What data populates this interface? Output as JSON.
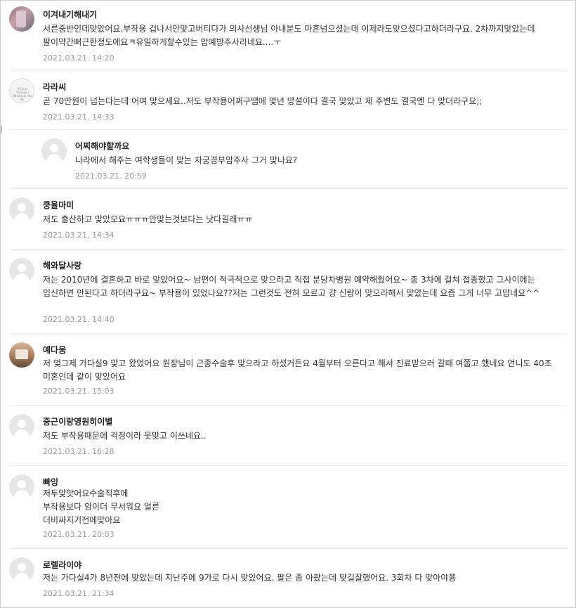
{
  "comments": [
    {
      "nickname": "이겨내기해내기",
      "text": "서른중반인데맞았어요.부작용 겁나서안맞고버티다가 의사선생님 아내분도 마흔넘으셨는데 이제라도맞으셨다고하더라구요. 2차까지맞았는데 팔이약간뻐근한정도에요ㅋ유일하게할수있는 암예방주사라네요....ㅜ",
      "date": "2021.03.21. 14:20"
    },
    {
      "nickname": "라라씨",
      "text": "곧 70만원이 넘는다는데 어여 맞으세요..저도 부작용어쩌구땜에 몇년 망설이다 결국 맞았고 제 주변도 결국엔 다 맞더라구요;;",
      "date": "2021.03.21. 14:33",
      "avatar_caption": "ll'S Just Vintage / Whatever You Ke"
    },
    {
      "nickname": "어찌해야할까요",
      "text": "나라에서 해주는 여학생들이 맞는 자궁경부암주사 그거 맞나요?",
      "date": "2021.03.21. 20:59"
    },
    {
      "nickname": "쿵율마미",
      "text": "저도 출산하고 맞았오요ㅠㅠㅠ안맞는것보다는 낫다길래ㅠㅠ",
      "date": "2021.03.21. 14:34"
    },
    {
      "nickname": "해와달사랑",
      "text": "저는 2010년에 결혼하고 바로 맞았어요~ 남편이 적극적으로 맞으라고 직접 분당차병원 예약해줬어요~ 총 3차에 걸쳐 접종했고 그사이에는 임신하면 안된다고 하더라구요~ 부작용이 있었나요??저는 그런것도 전혀 모르고 걍 신랑이 맞으라해서 맞았는데 요즘 그게 너무 고맙네요^^",
      "date": "2021.03.21. 14:40"
    },
    {
      "nickname": "예다움",
      "text": "저 엊그제 가다실9 맞고 왔었어요 원장님이 근종수술후 맞으라고 하셨거든요 4월부터 오른다고 해서 진료받으러 갈때 여쭙고 했네요 언니도 40조 미혼인데 같이 맞았어요",
      "date": "2021.03.21. 15:03"
    },
    {
      "nickname": "중근이랑영원히이별",
      "text": "저도 부작용때문에 걱정이라 못맞고 이쓰네요..",
      "date": "2021.03.21. 16:28"
    },
    {
      "nickname": "빠잉",
      "text": "저두맞앗어요수술직후에\n부작용보다 암이더 무서워요 얼른\n더비싸지기전에맞아요",
      "date": "2021.03.21. 20:03"
    },
    {
      "nickname": "로렐라이야",
      "text": "저는 가다실4가 8년전에 맞았는데 지난주에 9가로 다시 맞았어요. 팔은 좀 아팠는데 맞길잘했어요. 3회차 다 맞아야쭁",
      "date": "2021.03.21. 21:34"
    }
  ]
}
